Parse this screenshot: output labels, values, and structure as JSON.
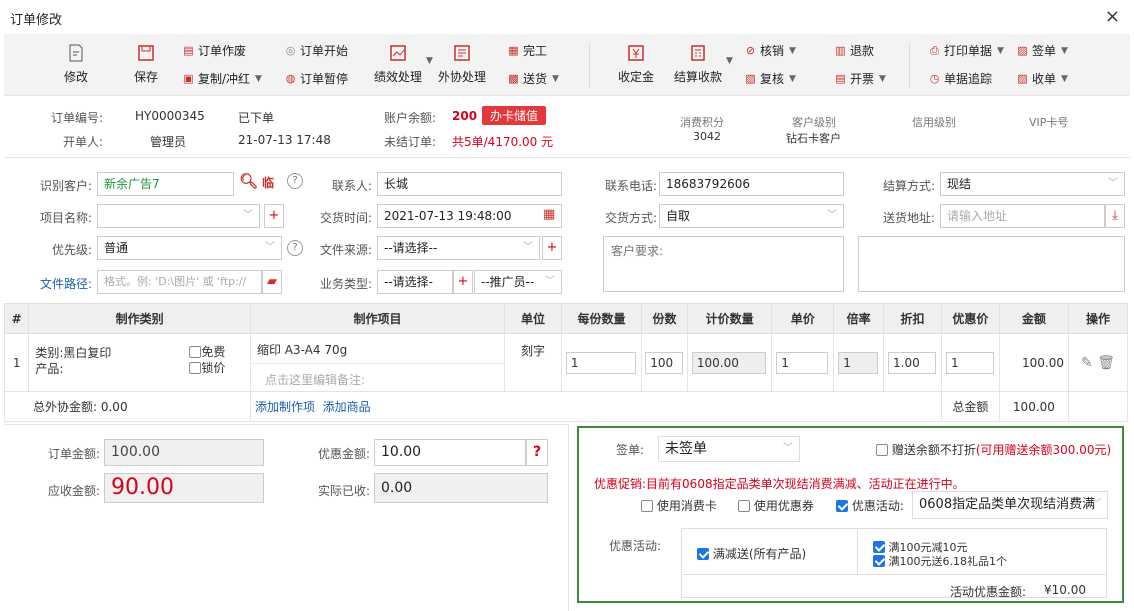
{
  "window": {
    "title": "订单修改",
    "close": "×"
  },
  "toolbar": {
    "modify": "修改",
    "save": "保存",
    "void": "订单作废",
    "copy": "复制/冲红",
    "start": "订单开始",
    "pause": "订单暂停",
    "perf": "绩效处理",
    "outsource": "外协处理",
    "finish": "完工",
    "deliver": "送货",
    "deposit": "收定金",
    "settle": "结算收款",
    "writeoff": "核销",
    "review": "复核",
    "refund": "退款",
    "invoice": "开票",
    "print": "打印单据",
    "sign": "签单",
    "track": "单据追踪",
    "receipt": "收单"
  },
  "info": {
    "order_no_label": "订单编号:",
    "order_no": "HY0000345",
    "status": "已下单",
    "opener_label": "开单人:",
    "opener": "管理员",
    "open_time": "21-07-13 17:48",
    "balance_label": "账户余额:",
    "balance": "200",
    "recharge": "办卡储值",
    "unsettled_label": "未结订单:",
    "unsettled": "共5单/4170.00 元",
    "points_label": "消费积分",
    "points": "3042",
    "level_label": "客户级别",
    "level": "钻石卡客户",
    "credit_label": "信用级别",
    "vip_label": "VIP卡号"
  },
  "form": {
    "customer_label": "识别客户:",
    "customer": "新余广告7",
    "temp": "临",
    "contact_label": "联系人:",
    "contact": "长城",
    "phone_label": "联系电话:",
    "phone": "18683792606",
    "settle_label": "结算方式:",
    "settle": "现结",
    "project_label": "项目名称:",
    "delivery_time_label": "交货时间:",
    "delivery_time": "2021-07-13 19:48:00",
    "delivery_method_label": "交货方式:",
    "delivery_method": "自取",
    "address_label": "送货地址:",
    "address_placeholder": "请输入地址",
    "priority_label": "优先级:",
    "priority": "普通",
    "source_label": "文件来源:",
    "source": "--请选择--",
    "requirement_label": "客户要求:",
    "path_label": "文件路径:",
    "path_placeholder": "格式。例: 'D:\\图片' 或 'ftp://",
    "biz_label": "业务类型:",
    "biz": "--请选择-",
    "promoter": "--推广员--"
  },
  "grid": {
    "headers": [
      "#",
      "制作类别",
      "制作项目",
      "单位",
      "每份数量",
      "份数",
      "计价数量",
      "单价",
      "倍率",
      "折扣",
      "优惠价",
      "金额",
      "操作"
    ],
    "row": {
      "idx": "1",
      "category": "类别:黑白复印",
      "product": "产品:",
      "free": "免费",
      "lock": "锁价",
      "item": "缩印 A3-A4 70g",
      "note": "点击这里编辑备注:",
      "unit": "刻字",
      "per_qty": "1",
      "copies": "100",
      "calc_qty": "100.00",
      "price": "1",
      "rate": "1",
      "discount": "1.00",
      "special": "1",
      "amount": "100.00"
    },
    "footer": {
      "outsource": "总外协金额: 0.00",
      "add_item": "添加制作项",
      "add_goods": "添加商品",
      "total_label": "总金额",
      "total": "100.00"
    }
  },
  "summary": {
    "order_amount_label": "订单金额:",
    "order_amount": "100.00",
    "discount_label": "优惠金额:",
    "discount": "10.00",
    "help": "?",
    "receivable_label": "应收金额:",
    "receivable": "90.00",
    "received_label": "实际已收:",
    "received": "0.00"
  },
  "promo": {
    "sign_label": "签单:",
    "sign_value": "未签单",
    "no_discount_gift": "赠送余额不打折",
    "gift_avail": "(可用赠送余额300.00元)",
    "notice": "优惠促销:目前有0608指定品类单次现结消费满减、活动正在进行中。",
    "use_card": "使用消费卡",
    "use_coupon": "使用优惠券",
    "use_activity": "优惠活动:",
    "activity_select": "0608指定品类单次现结消费满",
    "activity_label": "优惠活动:",
    "mode": "满减送(所有产品)",
    "rule1": "满100元减10元",
    "rule2": "满100元送6.18礼品1个",
    "total_label": "活动优惠金额:",
    "total": "¥10.00"
  }
}
